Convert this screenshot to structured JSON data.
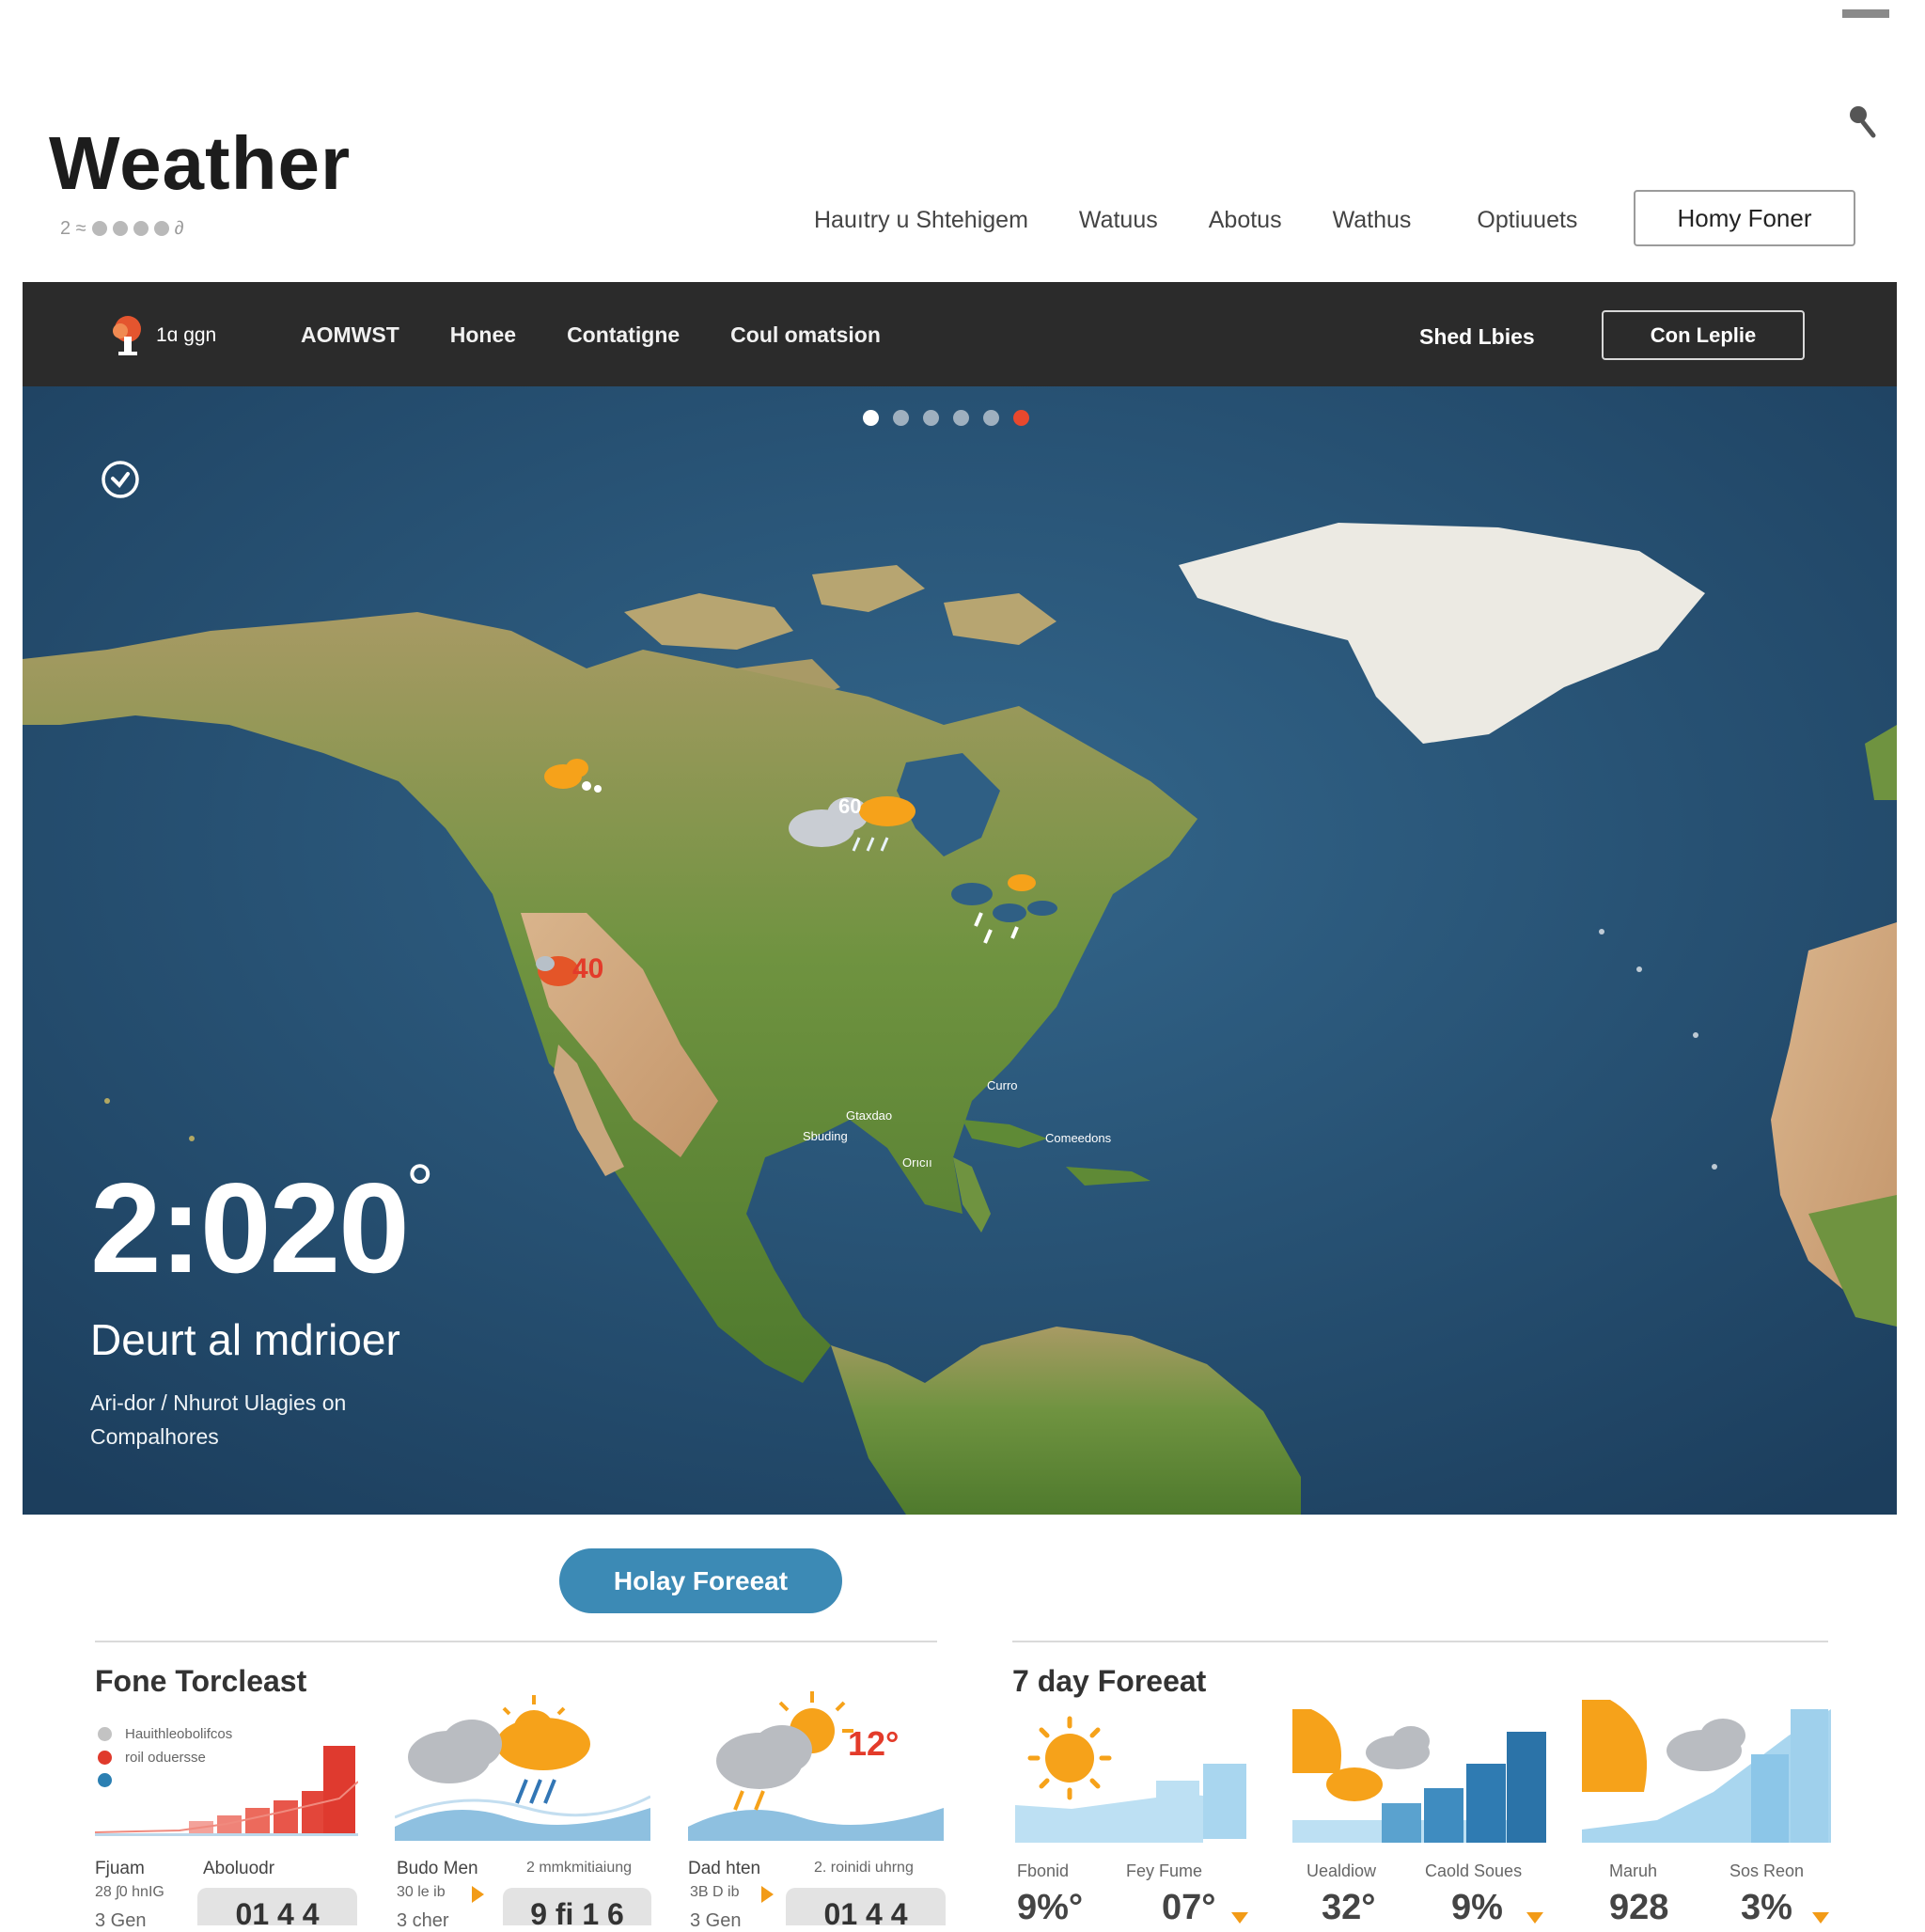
{
  "header": {
    "title": "Weather",
    "subtitle_prefix": "2 ≈",
    "subtitle_suffix": "∂",
    "nav": [
      "Hauıtry u Shtehigem",
      "Watuus",
      "Abotus",
      "Wathus",
      "Optiuuets"
    ],
    "cta": "Homy Foner"
  },
  "dark_nav": {
    "brand_text": "1ɑ ggn",
    "links": [
      "AOMWST",
      "Honee",
      "Contatigne",
      "Coul omatsion"
    ],
    "extra_link": "Shed Lbies",
    "cta": "Con Leplie"
  },
  "hero": {
    "temperature": "2:020",
    "degree_symbol": "°",
    "location": "Deurt al mdrioer",
    "description": "Ari-dor / Nhurot Ulagies on Compalhores",
    "carousel_count": 6,
    "carousel_active": 6,
    "map_temps": [
      "40",
      "60"
    ],
    "map_labels": [
      "Gtaxdao",
      "Sbuding",
      "Orıcıı",
      "Curro",
      "Comeedons"
    ]
  },
  "forecast_button": "Holay Foreeat",
  "left_section": {
    "title": "Fone Torcleast",
    "legend": [
      {
        "label": "Hauithleobolifcos",
        "color": "#c3c3c3"
      },
      {
        "label": "roil oduersse",
        "color": "#e03a2c"
      },
      {
        "label": "",
        "color": "#2b7fb2"
      }
    ],
    "cards": [
      {
        "label_a": "Fjuam",
        "label_b": "Aboluodr",
        "small": "28 ʃ0 hnIG",
        "bottom_left": "3 Gen",
        "pill": "01 4 4"
      },
      {
        "label_a": "Budo Men",
        "label_b": "2 mmkmitiaiung",
        "small": "30 le ib",
        "bottom_left": "3 cher",
        "pill": "9 fi 1 6"
      },
      {
        "label_a": "Dad hten",
        "label_b": "2. roinidi uhrng",
        "small": "3B D ib",
        "bottom_left": "3 Gen",
        "pill": "01 4 4"
      }
    ],
    "card_temp": "12°"
  },
  "right_section": {
    "title": "7 day Foreeat",
    "stats": [
      {
        "label": "Fbonid",
        "value": "9%°"
      },
      {
        "label": "Fey Fume",
        "value": "07°"
      },
      {
        "label": "Uealdiow",
        "value": "32°"
      },
      {
        "label": "Caold Soues",
        "value": "9%"
      },
      {
        "label": "Maruh",
        "value": "928"
      },
      {
        "label": "Sos Reon",
        "value": "3%"
      }
    ]
  },
  "colors": {
    "accent": "#3c8ab5",
    "dark_bar": "#2b2b2b",
    "ocean": "#2a577a",
    "land": "#6f9340",
    "sun": "#f6a21a",
    "alert": "#e33b2a"
  }
}
